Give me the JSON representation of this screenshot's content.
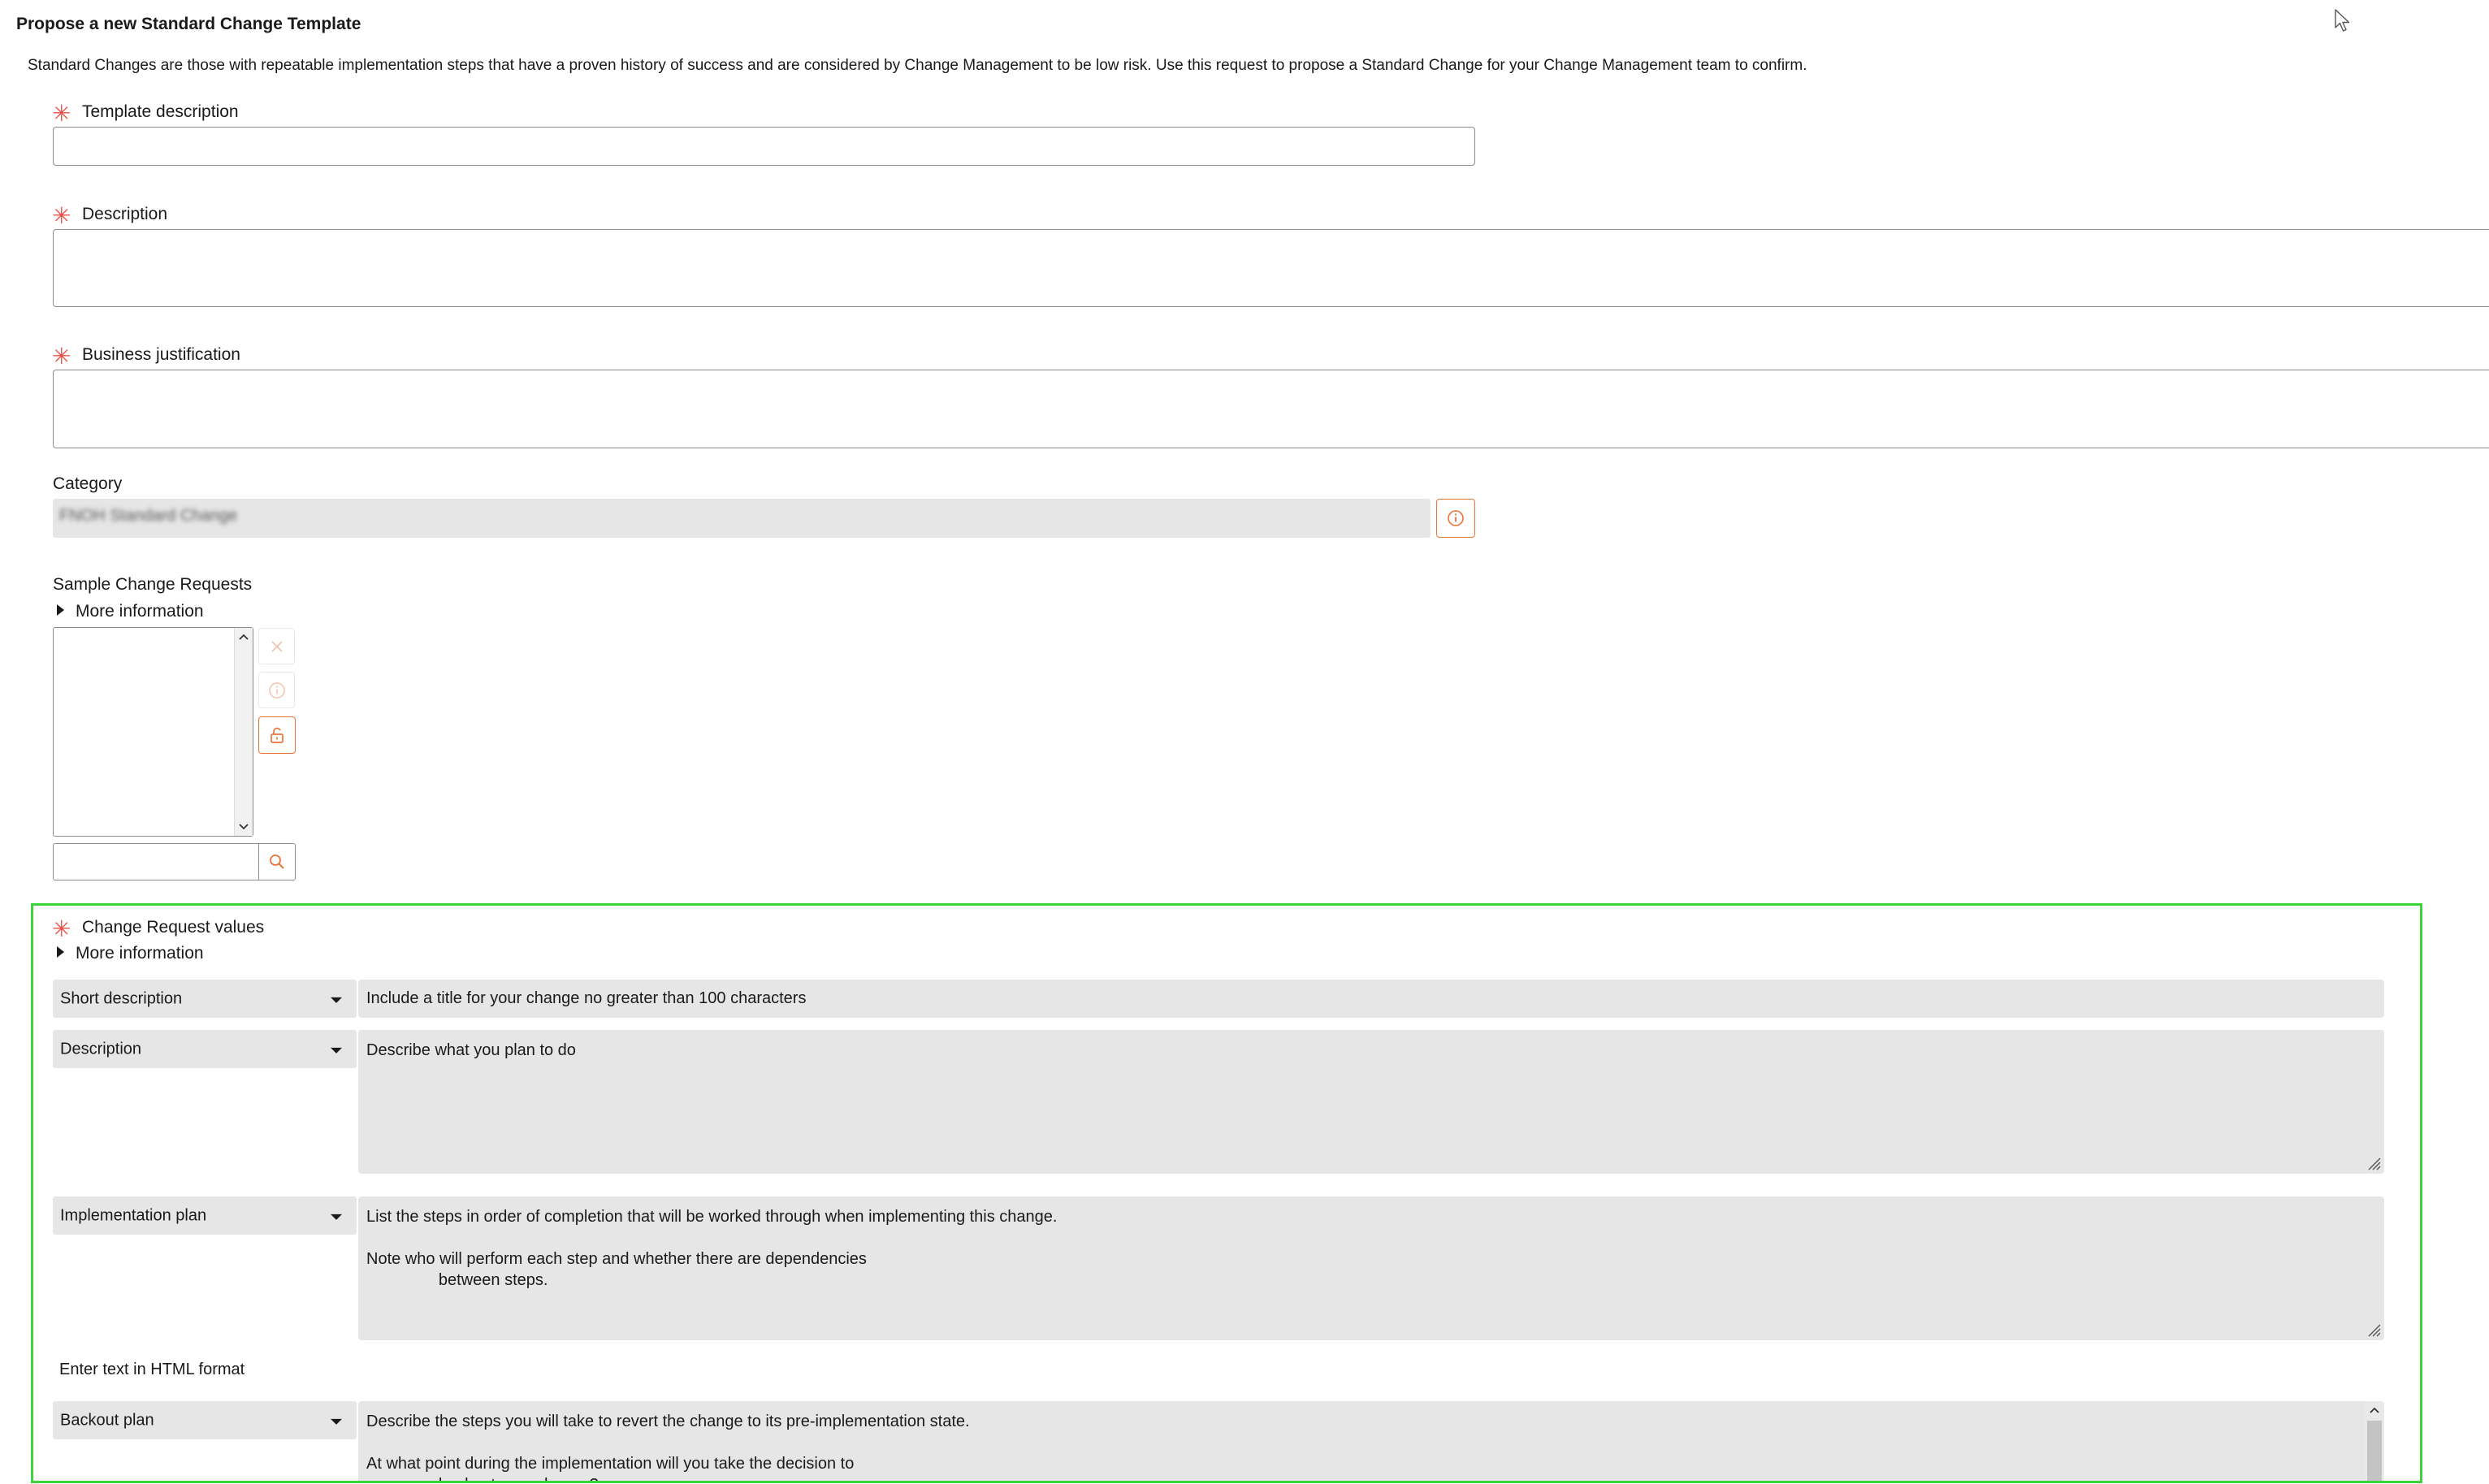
{
  "form": {
    "title": "Propose a new Standard Change Template",
    "intro": "Standard Changes are those with repeatable implementation steps that have a proven history of success and are considered by Change Management to be low risk. Use this request to propose a Standard Change for your Change Management team to confirm.",
    "required_marker": "✳"
  },
  "fields": {
    "template_description": {
      "label": "Template description",
      "value": ""
    },
    "description": {
      "label": "Description",
      "value": ""
    },
    "business_justification": {
      "label": "Business justification",
      "value": ""
    },
    "category": {
      "label": "Category",
      "value": "FNOH Standard Change"
    }
  },
  "sample_change_requests": {
    "label": "Sample Change Requests",
    "more_info": "More information",
    "search_value": ""
  },
  "change_request_values": {
    "label": "Change Request values",
    "more_info": "More information",
    "html_hint": "Enter text in HTML format",
    "rows": [
      {
        "field": "Short description",
        "value": "Include a title for your change no greater than 100 characters"
      },
      {
        "field": "Description",
        "value": "Describe what you plan to do"
      },
      {
        "field": "Implementation plan",
        "value": "List the steps in order of completion that will be worked through when implementing this change.\n\nNote who will perform each step and whether there are dependencies\n                between steps."
      },
      {
        "field": "Backout plan",
        "value": "Describe the steps you will take to revert the change to its pre-implementation state.\n\nAt what point during the implementation will you take the decision to\n                backout your change?"
      }
    ]
  },
  "icons": {
    "info": "info-icon",
    "remove": "close-icon",
    "unlock": "unlock-icon",
    "search": "search-icon",
    "resize": "resize-grip-icon",
    "cursor": "mouse-cursor-icon"
  },
  "colors": {
    "required": "#e8524a",
    "accent": "#e8743b",
    "highlight": "#3cd43c",
    "readonly_bg": "#e6e6e6"
  }
}
